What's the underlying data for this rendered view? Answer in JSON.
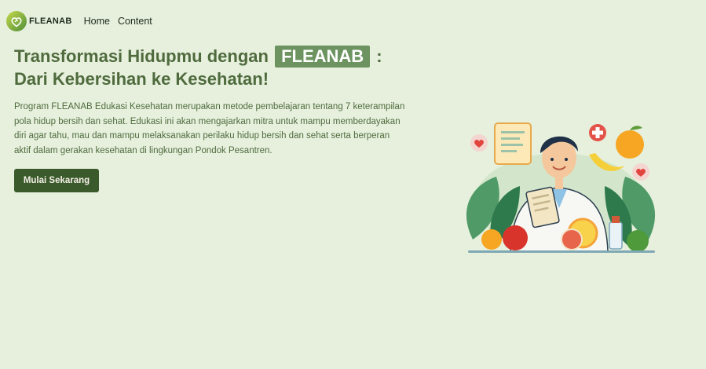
{
  "navbar": {
    "brand": "FLEANAB",
    "logo_icon": "heart-leaf-icon",
    "links": [
      {
        "label": "Home"
      },
      {
        "label": "Content"
      }
    ]
  },
  "hero": {
    "title_part1": "Transformasi Hidupmu dengan",
    "title_highlight": "FLEANAB",
    "title_part2": ":",
    "title_line2": "Dari Kebersihan ke Kesehatan!",
    "description": "Program FLEANAB Edukasi Kesehatan merupakan metode pembelajaran tentang 7 keterampilan pola hidup bersih dan sehat. Edukasi ini akan mengajarkan mitra untuk mampu memberdayakan diri agar tahu, mau dan mampu melaksanakan perilaku hidup bersih dan sehat serta berperan aktif dalam gerakan kesehatan di lingkungan Pondok Pesantren.",
    "cta_label": "Mulai Sekarang"
  },
  "illustration": {
    "subject": "doctor-with-clipboard-fruits-illustration"
  },
  "colors": {
    "background": "#e6f0dd",
    "heading": "#4f6b3d",
    "highlight_bg": "#6d9460",
    "button_bg": "#3a5a2c",
    "button_text": "#f5f0e6"
  }
}
